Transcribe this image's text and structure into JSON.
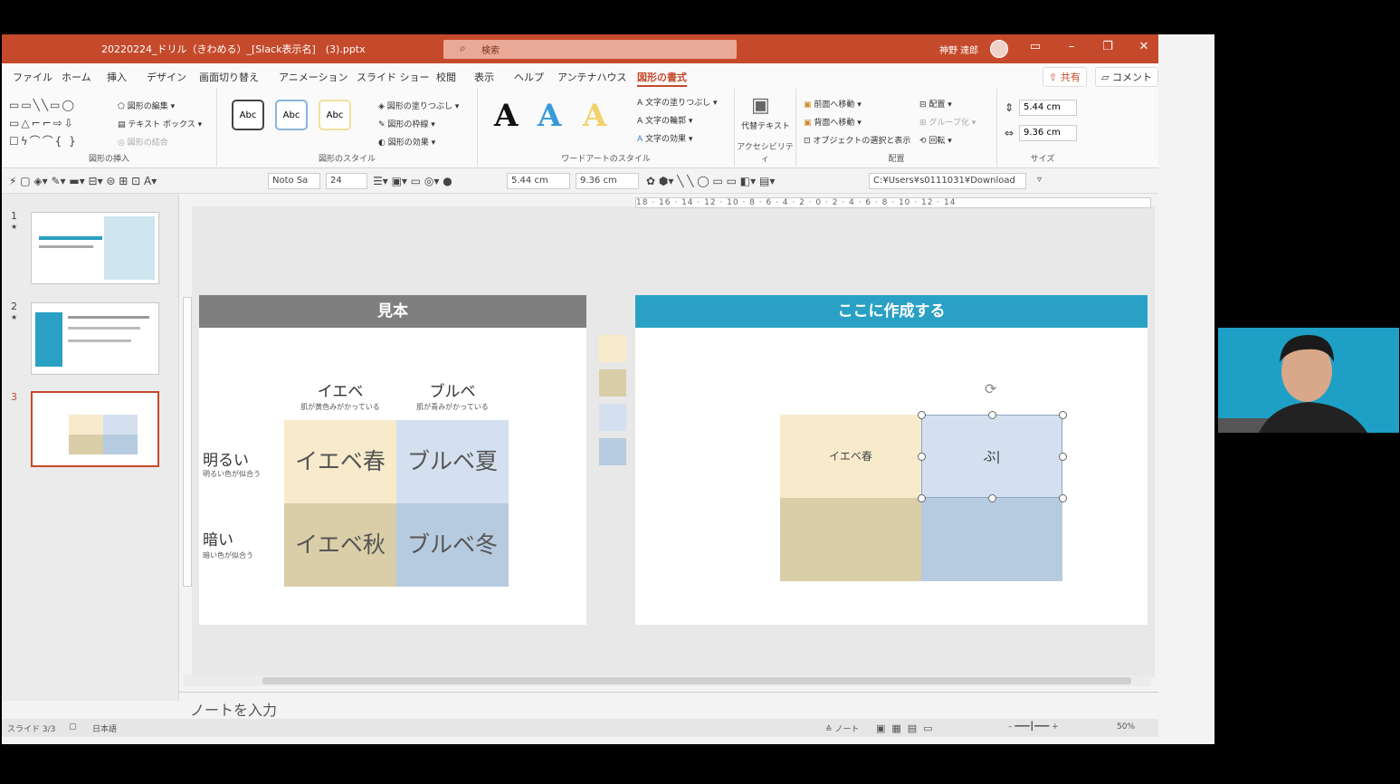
{
  "window": {
    "title": "20220224_ドリル（きわめる）_[Slack表示名]　(3).pptx",
    "search_placeholder": "検索",
    "user_name": "神野 達郎",
    "controls": [
      "▭",
      "–",
      "❐",
      "✕"
    ]
  },
  "ribbon_tabs": [
    "ファイル",
    "ホーム",
    "挿入",
    "デザイン",
    "画面切り替え",
    "アニメーション",
    "スライド ショー",
    "校閲",
    "表示",
    "ヘルプ",
    "アンテナハウス",
    "図形の書式"
  ],
  "ribbon_buttons": {
    "share": "共有",
    "comment": "コメント"
  },
  "ribbon": {
    "insert_shapes": {
      "label": "図形の挿入",
      "edit_shape": "図形の編集",
      "text_box": "テキスト ボックス",
      "merge_shapes": "図形の結合"
    },
    "shape_styles": {
      "label": "図形のスタイル",
      "style_sample": "Abc",
      "fill": "図形の塗りつぶし",
      "outline": "図形の枠線",
      "effects": "図形の効果"
    },
    "wordart": {
      "label": "ワードアートのスタイル",
      "letter": "A",
      "text_fill": "文字の塗りつぶし",
      "text_outline": "文字の輪郭",
      "text_effects": "文字の効果"
    },
    "accessibility": {
      "label": "アクセシビリティ",
      "alt_text": "代替テキスト"
    },
    "arrange": {
      "label": "配置",
      "bring_forward": "前面へ移動",
      "send_backward": "背面へ移動",
      "selection_pane": "オブジェクトの選択と表示",
      "align": "配置",
      "group": "グループ化",
      "rotate": "回転"
    },
    "size": {
      "label": "サイズ",
      "height": "5.44 cm",
      "width": "9.36 cm"
    }
  },
  "quick_toolbar": {
    "font": "Noto Sa",
    "font_size": "24",
    "height": "5.44 cm",
    "width": "9.36 cm",
    "path": "C:¥Users¥s0111031¥Download"
  },
  "ruler_text": "18 · 16 · 14 · 12 · 10 · 8 · 6 · 4 · 2 · 0 · 2 · 4 · 6 · 8 · 10 · 12 · 14",
  "slides": [
    {
      "number": "1",
      "star": "★"
    },
    {
      "number": "2",
      "star": "★"
    },
    {
      "number": "3",
      "star": ""
    }
  ],
  "sample_panel": {
    "header": "見本",
    "col1": {
      "title": "イエベ",
      "sub": "肌が黄色みがかっている"
    },
    "col2": {
      "title": "ブルベ",
      "sub": "肌が青みがかっている"
    },
    "row1": {
      "title": "明るい",
      "sub": "明るい色が似合う"
    },
    "row2": {
      "title": "暗い",
      "sub": "暗い色が似合う"
    },
    "cells": [
      "イエベ春",
      "ブルベ夏",
      "イエベ秋",
      "ブルベ冬"
    ]
  },
  "work_panel": {
    "header": "ここに作成する",
    "cell_text": "イエベ春",
    "editing_text": "ぶ|"
  },
  "colors": {
    "spring": "#f7ebcc",
    "summer": "#d4e0f0",
    "autumn": "#d9cea8",
    "winter": "#b7cbe0",
    "teal": "#2aa0c4",
    "accent": "#c54a2b"
  },
  "notes_placeholder": "ノートを入力",
  "status": {
    "slide": "スライド 3/3",
    "language": "日本語",
    "notes": "ノート",
    "zoom": "50%"
  },
  "webcam": {
    "overlay": ""
  }
}
